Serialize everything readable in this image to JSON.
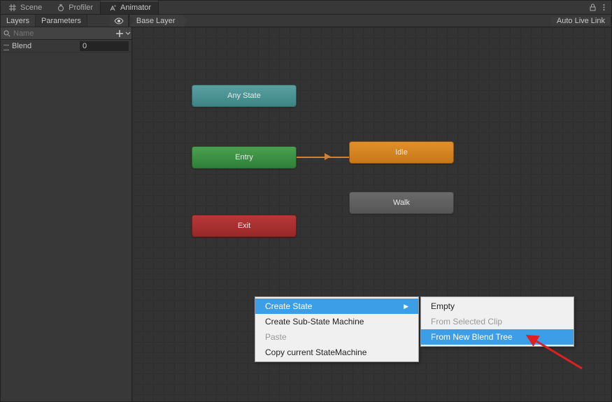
{
  "tabs": {
    "scene": "Scene",
    "profiler": "Profiler",
    "animator": "Animator"
  },
  "toolbar": {
    "layers": "Layers",
    "parameters": "Parameters",
    "breadcrumb": "Base Layer",
    "auto_live_link": "Auto Live Link"
  },
  "search": {
    "placeholder": "Name"
  },
  "params": [
    {
      "name": "Blend",
      "value": "0"
    }
  ],
  "nodes": {
    "anystate": "Any State",
    "entry": "Entry",
    "idle": "Idle",
    "walk": "Walk",
    "exit": "Exit"
  },
  "context_menu": {
    "create_state": "Create State",
    "create_sub_state": "Create Sub-State Machine",
    "paste": "Paste",
    "copy_current": "Copy current StateMachine"
  },
  "sub_menu": {
    "empty": "Empty",
    "from_selected": "From Selected Clip",
    "from_new_blend": "From New Blend Tree"
  }
}
